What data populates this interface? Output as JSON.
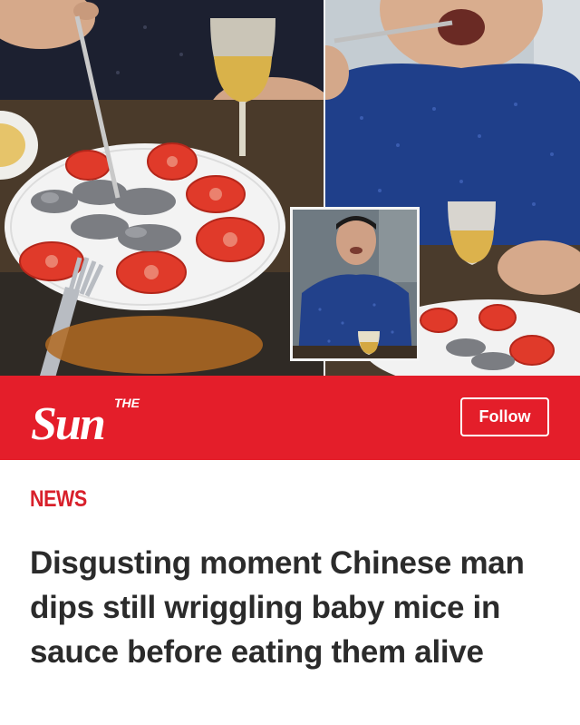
{
  "hero": {
    "description_icon": "photo-collage"
  },
  "brand": {
    "logo_the": "THE",
    "logo_name": "Sun",
    "follow_label": "Follow",
    "color": "#e41e2a"
  },
  "article": {
    "section": "NEWS",
    "section_color": "#d8202b",
    "headline": "Disgusting moment Chinese man dips still wriggling baby mice in sauce before eating them alive"
  }
}
